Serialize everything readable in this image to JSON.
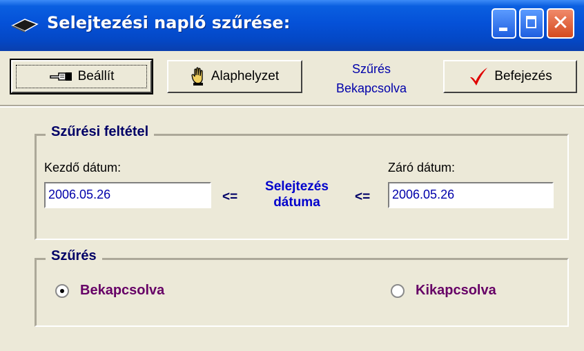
{
  "window": {
    "title": "Selejtezési napló szűrése:",
    "icon": "box-icon"
  },
  "toolbar": {
    "apply_label": "Beállít",
    "reset_label": "Alaphelyzet",
    "finish_label": "Befejezés",
    "filter_status_line1": "Szűrés",
    "filter_status_line2": "Bekapcsolva"
  },
  "criteria": {
    "legend": "Szűrési feltétel",
    "start_label": "Kezdő dátum:",
    "start_value": "2006.05.26",
    "end_label": "Záró dátum:",
    "end_value": "2006.05.26",
    "arrow_left": "<=",
    "arrow_right": "<=",
    "middle_line1": "Selejtezés",
    "middle_line2": "dátuma"
  },
  "filter": {
    "legend": "Szűrés",
    "on_label": "Bekapcsolva",
    "off_label": "Kikapcsolva",
    "selected": "on"
  },
  "colors": {
    "title_bar": "#0551d8",
    "value_text": "#0000aa",
    "radio_text": "#660066",
    "legend_text": "#000066"
  }
}
